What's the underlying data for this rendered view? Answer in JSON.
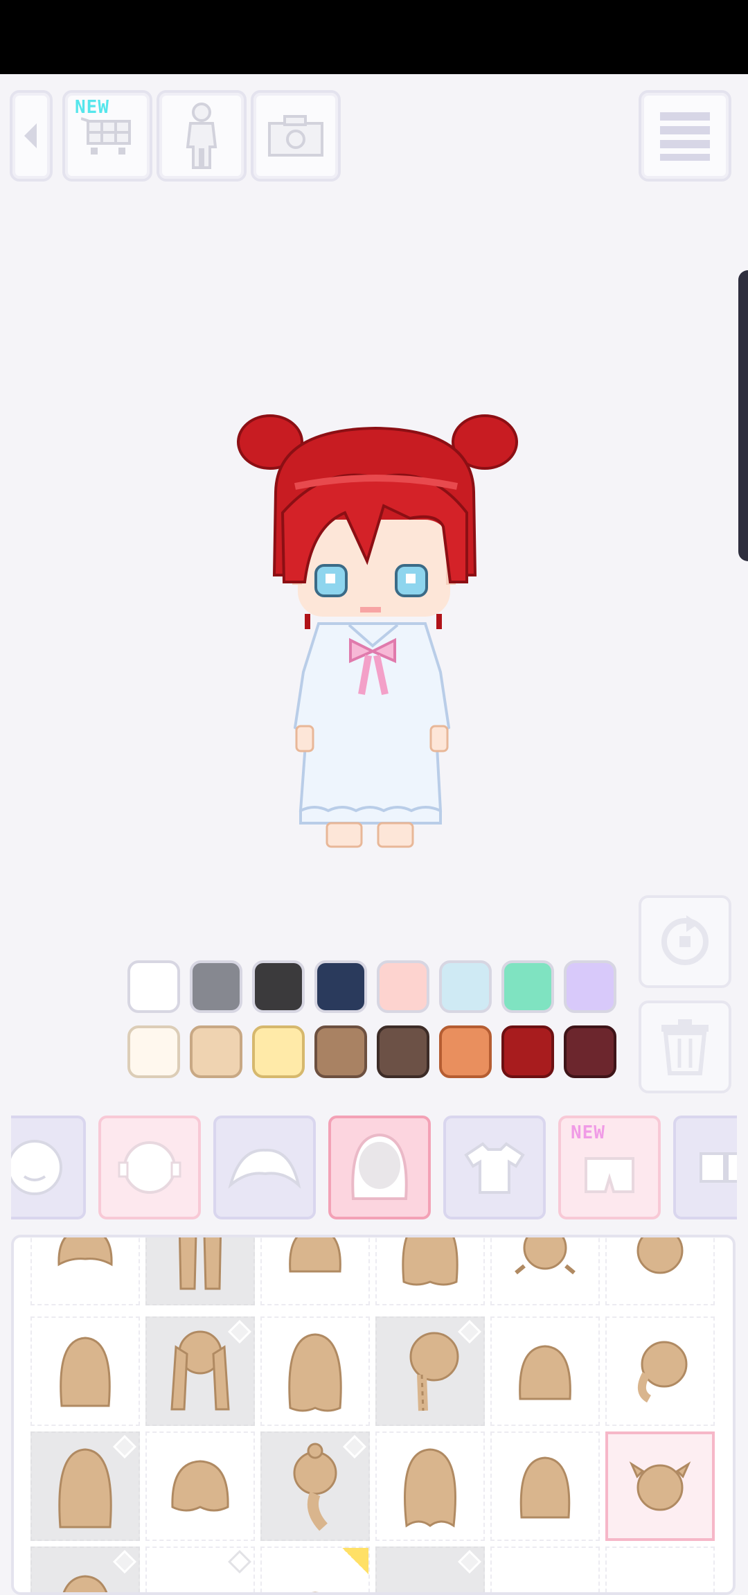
{
  "toolbar": {
    "back_icon": "back-arrow-icon",
    "shop_badge": "NEW",
    "items": [
      "shop-cart-icon",
      "body-icon",
      "camera-icon"
    ],
    "menu_icon": "menu-icon"
  },
  "palette": {
    "row1": [
      "#ffffff",
      "#868890",
      "#3b3a3c",
      "#2a3a5c",
      "#fdd3cf",
      "#cfeaf4",
      "#7fe3c1",
      "#d8c9fa"
    ],
    "row2": [
      "#fff8ee",
      "#efd3b1",
      "#ffeaa8",
      "#a98263",
      "#6c5146",
      "#e98f5e",
      "#a81c1e",
      "#6c262d"
    ]
  },
  "side_actions": [
    "undo-icon",
    "trash-icon"
  ],
  "categories": [
    {
      "name": "face",
      "style": "lavender"
    },
    {
      "name": "head",
      "style": "pink"
    },
    {
      "name": "bangs",
      "style": "lavender"
    },
    {
      "name": "back-hair",
      "style": "selected"
    },
    {
      "name": "top",
      "style": "lavender"
    },
    {
      "name": "bottom",
      "style": "pink",
      "badge": "NEW"
    },
    {
      "name": "shoes",
      "style": "lavender"
    }
  ],
  "hair_grid": {
    "hair_color": "#d9b58d",
    "selected_index": 17
  }
}
